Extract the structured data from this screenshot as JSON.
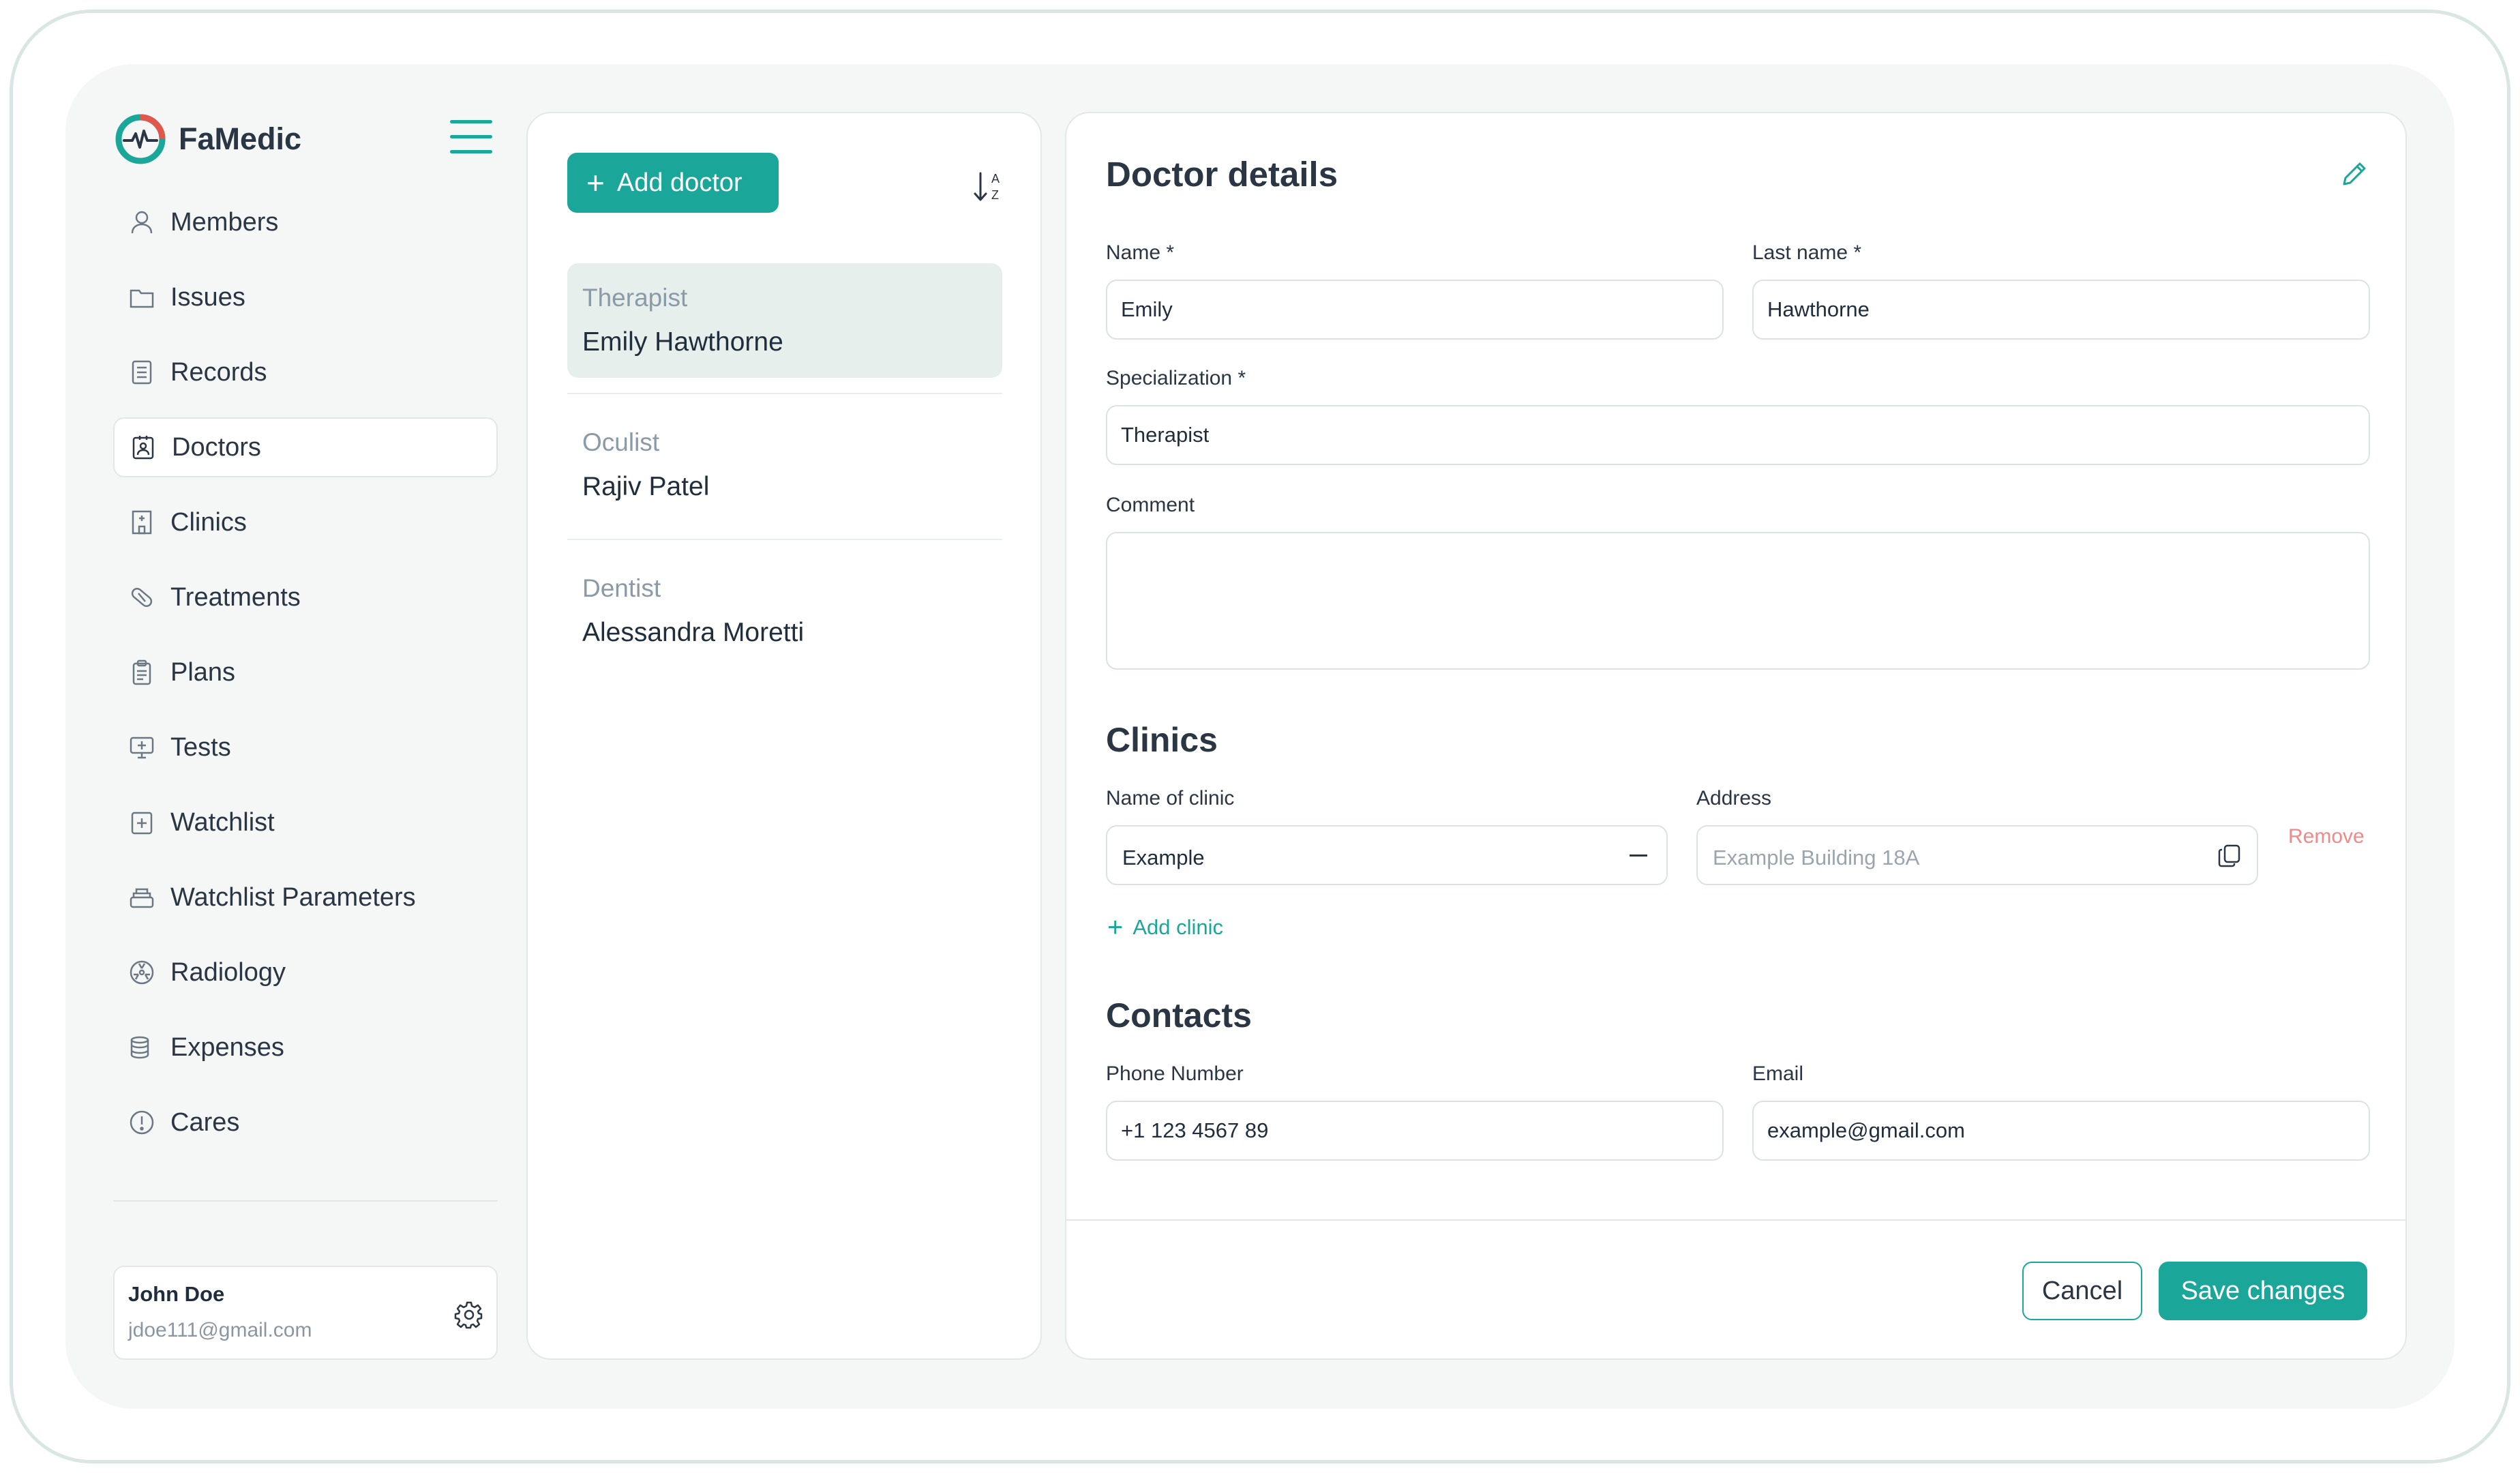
{
  "app": {
    "name": "FaMedic"
  },
  "sidebar": {
    "items": [
      {
        "label": "Members",
        "icon": "user-icon"
      },
      {
        "label": "Issues",
        "icon": "folder-icon"
      },
      {
        "label": "Records",
        "icon": "document-list-icon"
      },
      {
        "label": "Doctors",
        "icon": "doctor-badge-icon",
        "active": true
      },
      {
        "label": "Clinics",
        "icon": "hospital-icon"
      },
      {
        "label": "Treatments",
        "icon": "pill-icon"
      },
      {
        "label": "Plans",
        "icon": "clipboard-icon"
      },
      {
        "label": "Tests",
        "icon": "monitor-plus-icon"
      },
      {
        "label": "Watchlist",
        "icon": "calendar-plus-icon"
      },
      {
        "label": "Watchlist Parameters",
        "icon": "stack-icon"
      },
      {
        "label": "Radiology",
        "icon": "radiation-icon"
      },
      {
        "label": "Expenses",
        "icon": "coins-icon"
      },
      {
        "label": "Cares",
        "icon": "info-circle-icon"
      }
    ],
    "user": {
      "name": "John Doe",
      "email": "jdoe111@gmail.com"
    }
  },
  "doctor_list": {
    "add_label": "Add doctor",
    "items": [
      {
        "specialization": "Therapist",
        "name": "Emily Hawthorne",
        "selected": true
      },
      {
        "specialization": "Oculist",
        "name": "Rajiv Patel"
      },
      {
        "specialization": "Dentist",
        "name": "Alessandra Moretti"
      }
    ]
  },
  "details": {
    "title": "Doctor details",
    "name_label": "Name *",
    "name_value": "Emily",
    "last_name_label": "Last name *",
    "last_name_value": "Hawthorne",
    "specialization_label": "Specialization *",
    "specialization_value": "Therapist",
    "comment_label": "Comment",
    "comment_value": "",
    "clinics": {
      "title": "Clinics",
      "name_label": "Name of clinic",
      "name_value": "Example",
      "address_label": "Address",
      "address_placeholder": "Example Building 18A",
      "remove_label": "Remove",
      "add_label": "Add clinic"
    },
    "contacts": {
      "title": "Contacts",
      "phone_label": "Phone Number",
      "phone_value": "+1 123 4567 89",
      "email_label": "Email",
      "email_value": "example@gmail.com"
    },
    "cancel_label": "Cancel",
    "save_label": "Save changes"
  },
  "colors": {
    "accent": "#1ba69a",
    "danger": "#f08a8a",
    "selected_bg": "#e6efec"
  }
}
